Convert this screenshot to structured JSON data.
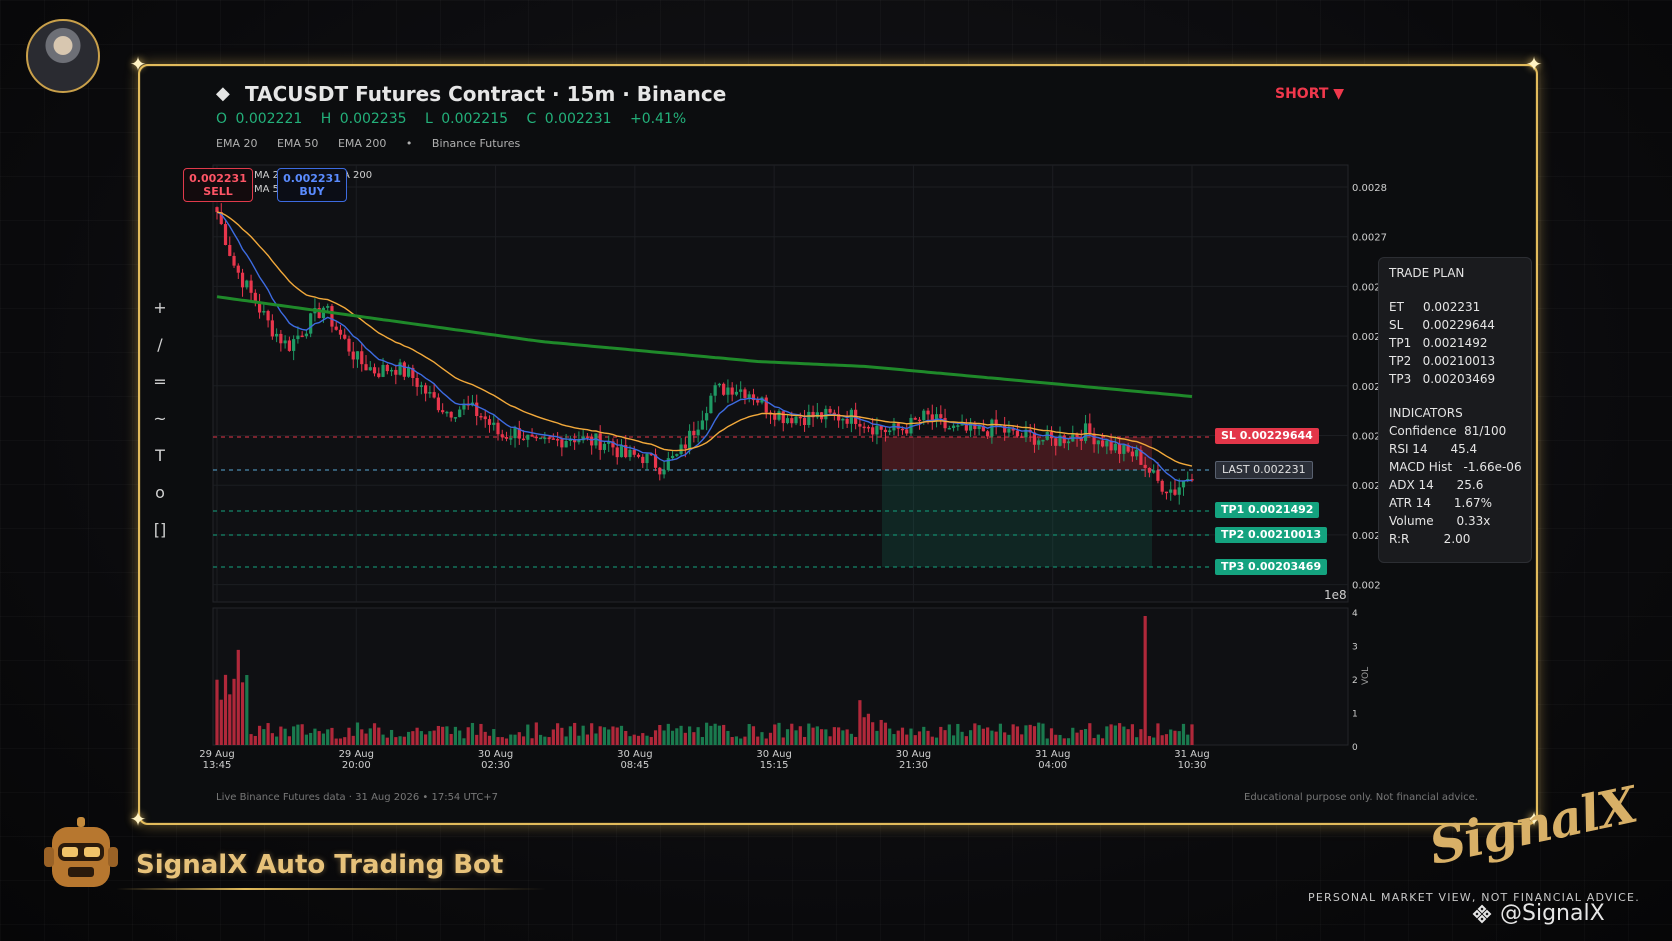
{
  "header": {
    "title": "TACUSDT Futures Contract  ·  15m  ·  Binance",
    "ohlc": {
      "o": "O 0.002221",
      "h": "H 0.002235",
      "l": "L 0.002215",
      "c": "C 0.002231",
      "chg": "+0.41%"
    },
    "indicators": [
      "EMA 20",
      "EMA 50",
      "EMA 200",
      "•",
      "Binance Futures"
    ],
    "direction": "SHORT ▼"
  },
  "toolbar": [
    "+",
    "/",
    "=",
    "~",
    "T",
    "o",
    "[]"
  ],
  "badges": {
    "sell_price": "0.002231",
    "sell_label": "SELL",
    "buy_price": "0.002231",
    "buy_label": "BUY"
  },
  "legend_fragments": {
    "l1": "MA 2",
    "l2": "MA 5",
    "l3": "A 200"
  },
  "levels": {
    "sl": "SL  0.00229644",
    "last": "LAST  0.002231",
    "tp1": "TP1  0.0021492",
    "tp2": "TP2  0.00210013",
    "tp3": "TP3  0.00203469"
  },
  "trade_plan": {
    "title": "TRADE PLAN",
    "rows": [
      "ET     0.002231",
      "SL     0.00229644",
      "TP1   0.0021492",
      "TP2   0.00210013",
      "TP3   0.00203469"
    ],
    "ind_title": "INDICATORS",
    "ind_rows": [
      "Confidence  81/100",
      "RSI 14      45.4",
      "MACD Hist   -1.66e-06",
      "ADX 14      25.6",
      "ATR 14      1.67%",
      "Volume      0.33x",
      "R:R         2.00"
    ]
  },
  "footer": {
    "left": "Live Binance Futures data  ·  31 Aug 2026 • 17:54 UTC+7",
    "right": "Educational purpose only. Not financial advice."
  },
  "branding": {
    "bot_title": "SignalX Auto Trading Bot",
    "logo_text": "SignalX",
    "disclaimer": "PERSONAL MARKET VIEW, NOT FINANCIAL ADVICE.",
    "handle": "@SignalX"
  },
  "colors": {
    "up": "#1f9a64",
    "down": "#e8364c",
    "ema20": "#3d6be0",
    "ema50": "#f2a93b",
    "ema200": "#1f8a2a",
    "gold": "#e2bb5c"
  },
  "chart_data": {
    "type": "candlestick",
    "ylim": [
      0.002,
      0.0028
    ],
    "y_ticks": [
      "0.0028",
      "0.0027",
      "0.002",
      "0.002",
      "0.002",
      "0.002",
      "0.002",
      "0.002",
      "0.002"
    ],
    "offset_label": "1e8",
    "x_ticks": [
      {
        "d": "29 Aug",
        "t": "13:45"
      },
      {
        "d": "29 Aug",
        "t": "20:00"
      },
      {
        "d": "30 Aug",
        "t": "02:30"
      },
      {
        "d": "30 Aug",
        "t": "08:45"
      },
      {
        "d": "30 Aug",
        "t": "15:15"
      },
      {
        "d": "30 Aug",
        "t": "21:30"
      },
      {
        "d": "31 Aug",
        "t": "04:00"
      },
      {
        "d": "31 Aug",
        "t": "10:30"
      }
    ],
    "close_path": [
      0.00275,
      0.00264,
      0.00258,
      0.00252,
      0.00248,
      0.00252,
      0.00256,
      0.0025,
      0.00245,
      0.00243,
      0.00244,
      0.00242,
      0.00238,
      0.00235,
      0.00236,
      0.00234,
      0.0023,
      0.00231,
      0.00228,
      0.00229,
      0.0023,
      0.00229,
      0.00229,
      0.00226,
      0.00226,
      0.00224,
      0.00226,
      0.00232,
      0.00239,
      0.0024,
      0.00239,
      0.00236,
      0.00234,
      0.00234,
      0.00234,
      0.00234,
      0.00234,
      0.00232,
      0.00231,
      0.00232,
      0.00234,
      0.00232,
      0.00231,
      0.00231,
      0.00232,
      0.0023,
      0.0023,
      0.00229,
      0.0023,
      0.00231,
      0.00229,
      0.00227,
      0.00226,
      0.00221,
      0.00219,
      0.00223
    ],
    "ema200": [
      0.00258,
      0.00255,
      0.00252,
      0.00249,
      0.00247,
      0.00245,
      0.00244,
      0.00242,
      0.0024,
      0.00238
    ],
    "volume_ylim": [
      0,
      4
    ],
    "volume_ticks": [
      "4",
      "3",
      "2",
      "1",
      "0"
    ],
    "volume_label": "VOL"
  }
}
